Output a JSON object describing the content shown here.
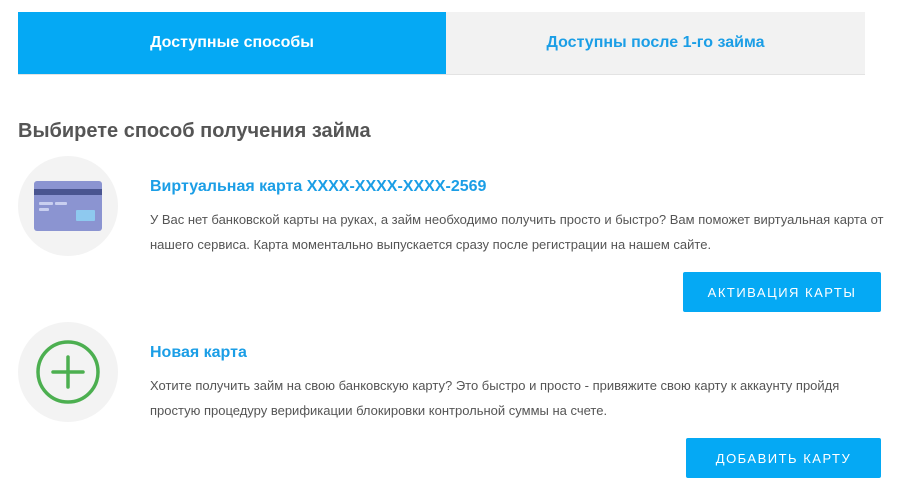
{
  "tabs": [
    {
      "label": "Доступные способы",
      "active": true
    },
    {
      "label": "Доступны после 1-го займа",
      "active": false
    }
  ],
  "heading": "Выбирете способ получения займа",
  "methods": [
    {
      "icon": "credit-card-icon",
      "title": "Виртуальная карта XXXX-XXXX-XXXX-2569",
      "description": "У Вас нет банковской карты на руках, а займ необходимо получить просто и быстро? Вам поможет виртуальная карта от нашего сервиса. Карта моментально выпускается сразу после регистрации на нашем сайте.",
      "button": "Активация карты"
    },
    {
      "icon": "plus-circle-icon",
      "title": "Новая карта",
      "description": "Хотите получить займ на свою банковскую карту? Это быстро и просто - привяжите свою карту к аккаунту пройдя простую процедуру верификации блокировки контрольной суммы на счете.",
      "button": "Добавить карту"
    }
  ],
  "colors": {
    "accent": "#05a9f4",
    "link": "#1b9ee6",
    "tab_inactive_bg": "#f2f2f2",
    "icon_bg": "#f3f3f3",
    "card": "#8b94d1",
    "plus": "#4caf50"
  }
}
